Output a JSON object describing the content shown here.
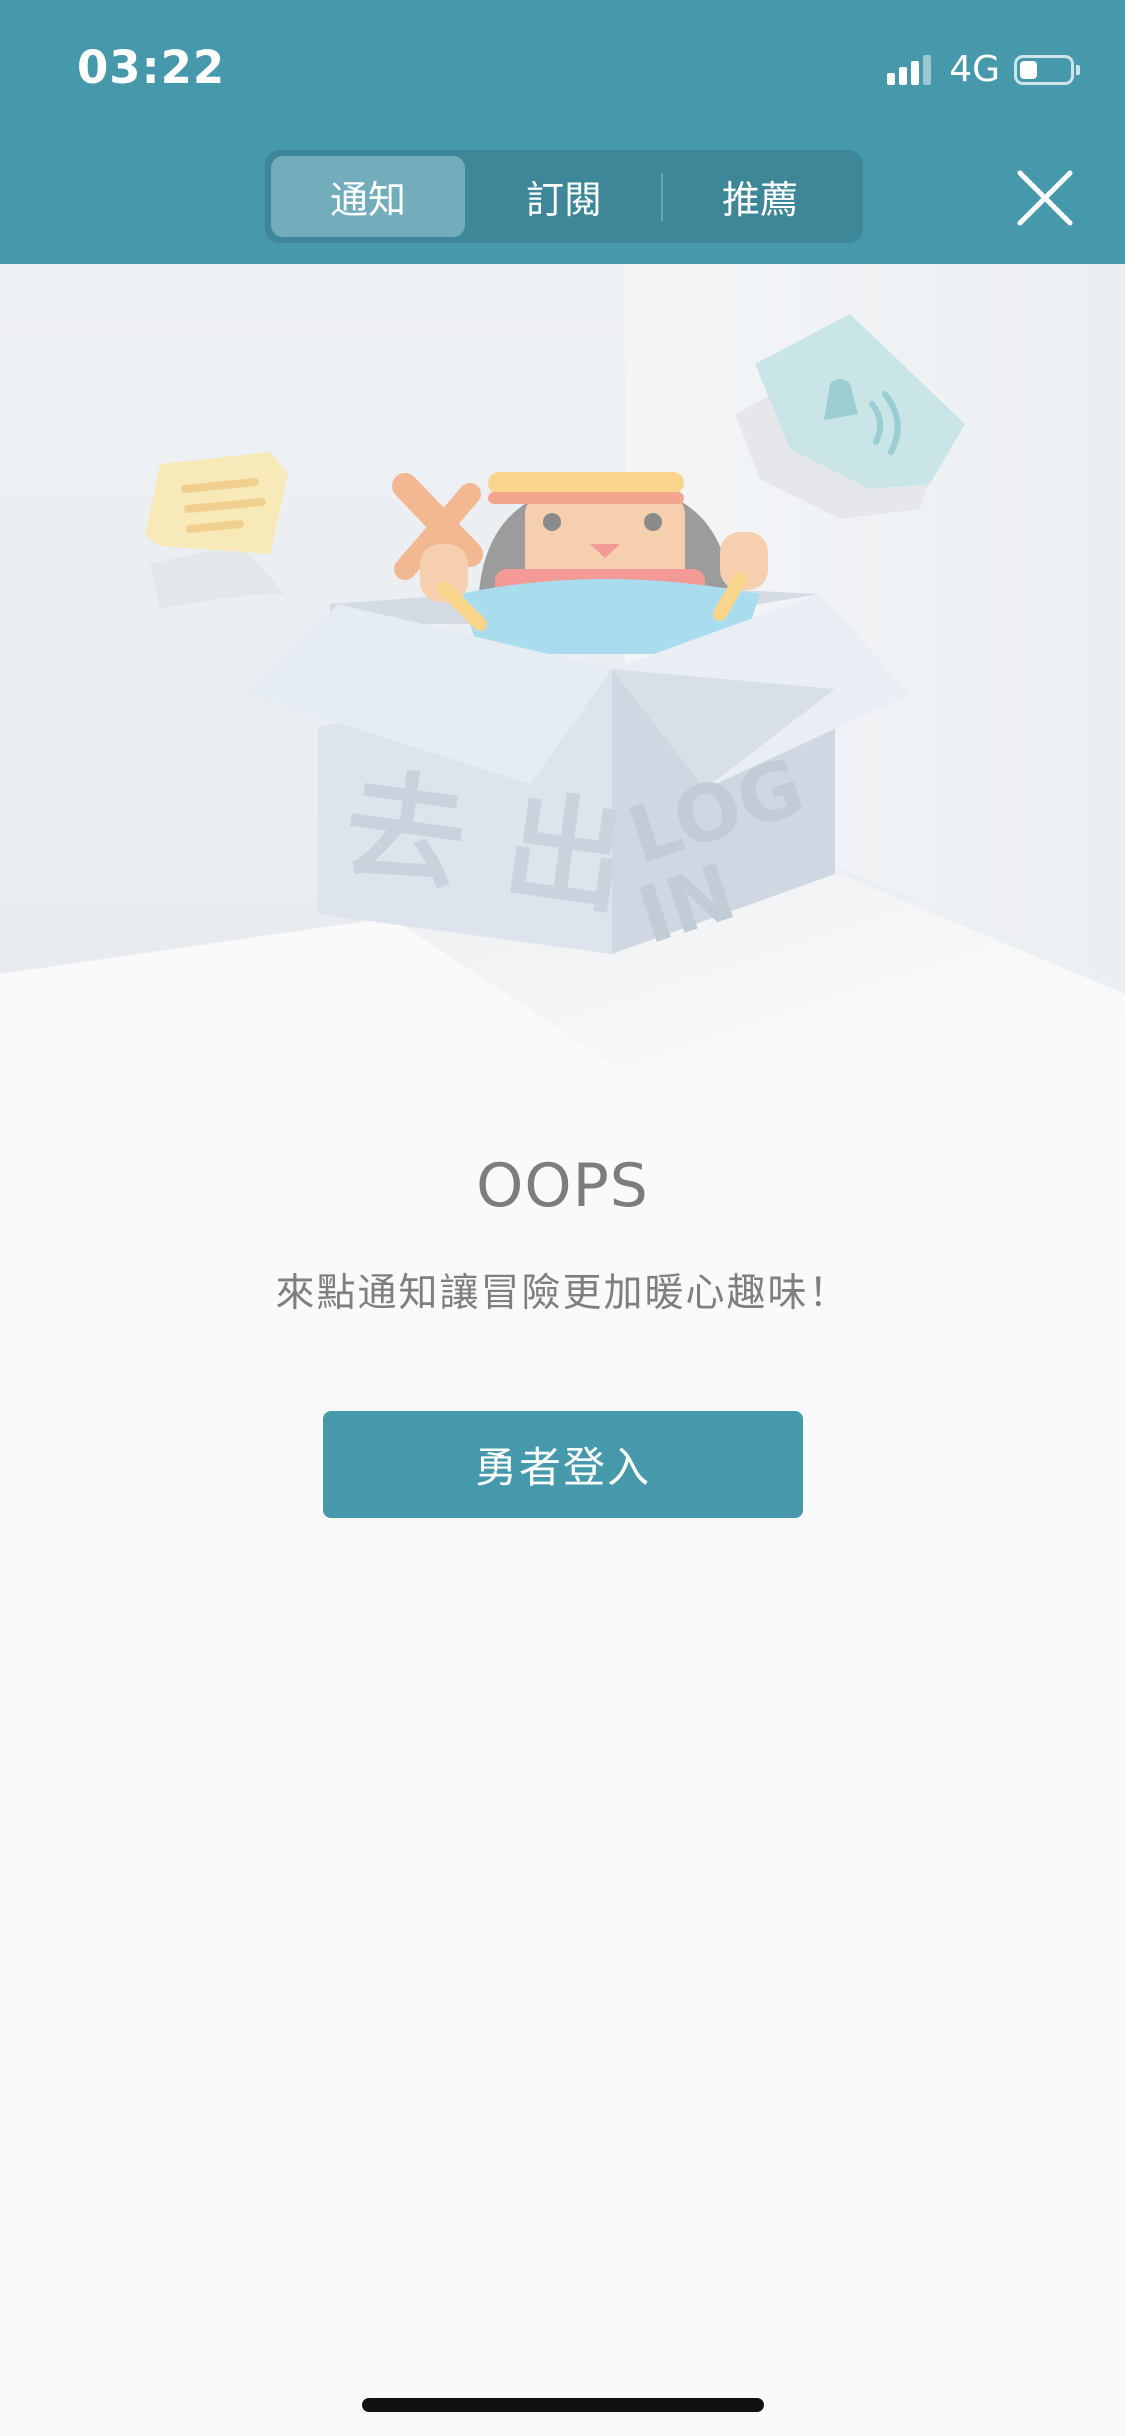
{
  "status_bar": {
    "time": "03:22",
    "network": "4G",
    "battery_level": 0.35
  },
  "nav": {
    "tabs": [
      {
        "label": "通知",
        "active": true
      },
      {
        "label": "訂閱",
        "active": false
      },
      {
        "label": "推薦",
        "active": false
      }
    ],
    "close_icon": "close-icon"
  },
  "illustration": {
    "box_icon": "character-in-box-illustration",
    "note_icon": "note-paper-icon",
    "bell_icon": "bell-paper-icon"
  },
  "empty_state": {
    "title": "OOPS",
    "message": "來點通知讓冒險更加暖心趣味！",
    "login_label": "勇者登入"
  },
  "colors": {
    "brand": "#4599aa",
    "segment_bg": "#3d8798",
    "segment_active": "#73adbc",
    "page_bg": "#fafafa"
  }
}
